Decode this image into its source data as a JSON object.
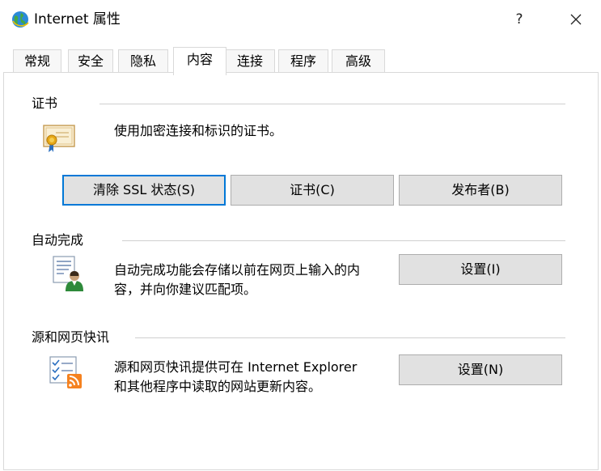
{
  "window": {
    "title": "Internet 属性",
    "help_label": "?"
  },
  "tabs": [
    {
      "label": "常规"
    },
    {
      "label": "安全"
    },
    {
      "label": "隐私"
    },
    {
      "label": "内容",
      "active": true
    },
    {
      "label": "连接"
    },
    {
      "label": "程序"
    },
    {
      "label": "高级"
    }
  ],
  "certificates": {
    "title": "证书",
    "description": "使用加密连接和标识的证书。",
    "buttons": {
      "clear_ssl": "清除 SSL 状态(S)",
      "certificates": "证书(C)",
      "publishers": "发布者(B)"
    }
  },
  "autocomplete": {
    "title": "自动完成",
    "description_line1": "自动完成功能会存储以前在网页上输入的内",
    "description_line2": "容，并向你建议匹配项。",
    "settings_button": "设置(I)"
  },
  "feeds": {
    "title": "源和网页快讯",
    "description_line1": "源和网页快讯提供可在 Internet Explorer",
    "description_line2": "和其他程序中读取的网站更新内容。",
    "settings_button": "设置(N)"
  },
  "colors": {
    "focus_border": "#0078d7",
    "button_face": "#e1e1e1",
    "button_border": "#adadad",
    "rss_orange": "#f58220"
  },
  "icons": [
    "globe-icon",
    "close-icon",
    "certificate-icon",
    "autocomplete-icon",
    "feeds-icon"
  ]
}
